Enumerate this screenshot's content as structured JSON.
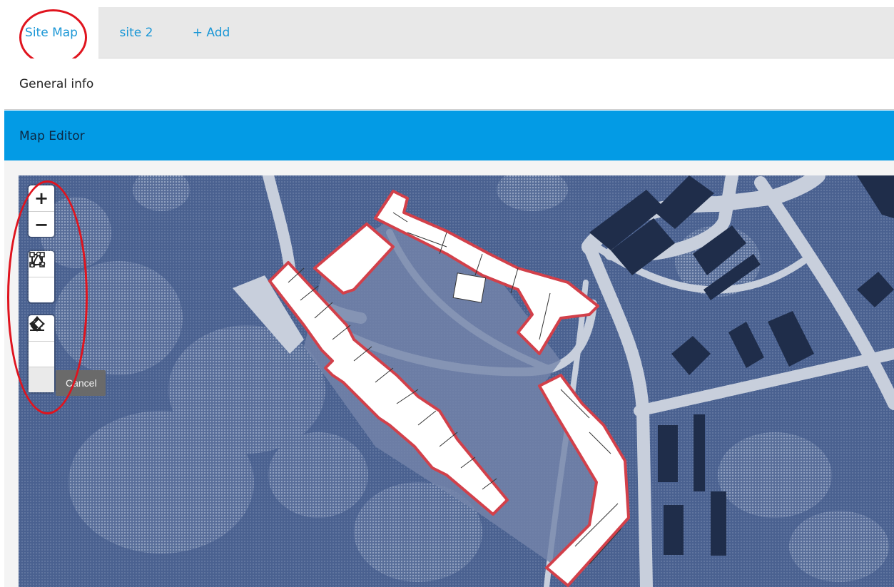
{
  "tabs": [
    {
      "label": "Site Map",
      "active": true
    },
    {
      "label": "site 2",
      "active": false
    },
    {
      "label": "+ Add",
      "active": false
    }
  ],
  "sections": {
    "general_info": "General info",
    "map_editor": "Map Editor"
  },
  "map": {
    "toolbar": {
      "zoom_in": "+",
      "zoom_out": "−",
      "tools": [
        "draw-rectangle-icon",
        "draw-polygon-icon",
        "select-cursor-icon",
        "move-icon",
        "eraser-icon"
      ]
    },
    "tooltip": "Cancel"
  },
  "colors": {
    "accent": "#039be5",
    "tab_text": "#1b97d6",
    "map_background": "#4c6390",
    "road": "#c8cfdc",
    "building_dark": "#1f2d4a",
    "selection_outline": "#d2404a",
    "annotation": "#e0141e"
  }
}
